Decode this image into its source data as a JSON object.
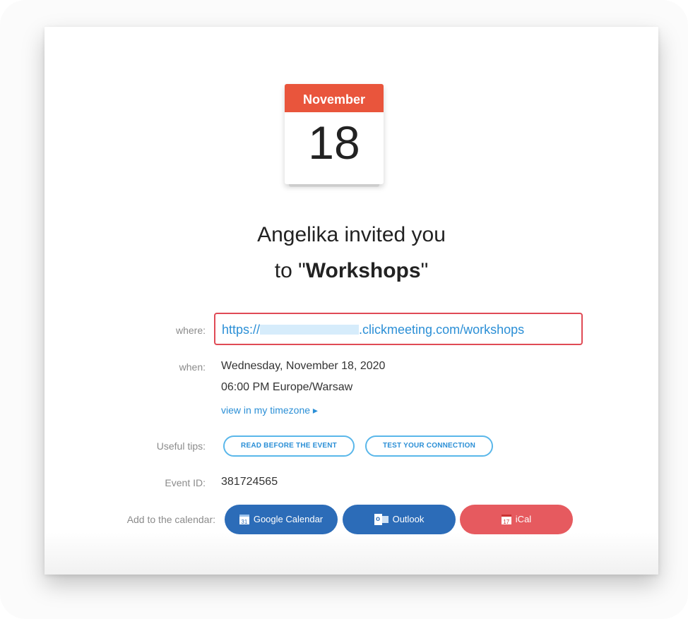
{
  "calendar": {
    "month": "November",
    "day": "18"
  },
  "heading": {
    "line1": "Angelika invited you",
    "line2_prefix": "to \"",
    "line2_name": "Workshops",
    "line2_suffix": "\""
  },
  "where": {
    "label": "where:",
    "url_prefix": "https://",
    "url_suffix": ".clickmeeting.com/workshops"
  },
  "when": {
    "label": "when:",
    "date": "Wednesday, November 18, 2020",
    "time": "06:00 PM Europe/Warsaw",
    "timezone_link": "view in my timezone ▸"
  },
  "tips": {
    "label": "Useful tips:",
    "read_before": "READ BEFORE THE EVENT",
    "test_connection": "TEST YOUR CONNECTION"
  },
  "event": {
    "label": "Event ID:",
    "id": "381724565"
  },
  "add_calendar": {
    "label": "Add to the calendar:",
    "google": "Google Calendar",
    "outlook": "Outlook",
    "ical": "iCal",
    "google_icon_text": "31",
    "ical_icon_text": "17",
    "outlook_icon_text": "o"
  },
  "colors": {
    "accent_red": "#e9553c",
    "link_blue": "#2b8fd6",
    "button_blue": "#2c6cb8",
    "button_red": "#e65a5f",
    "highlight_border": "#e04a55"
  }
}
